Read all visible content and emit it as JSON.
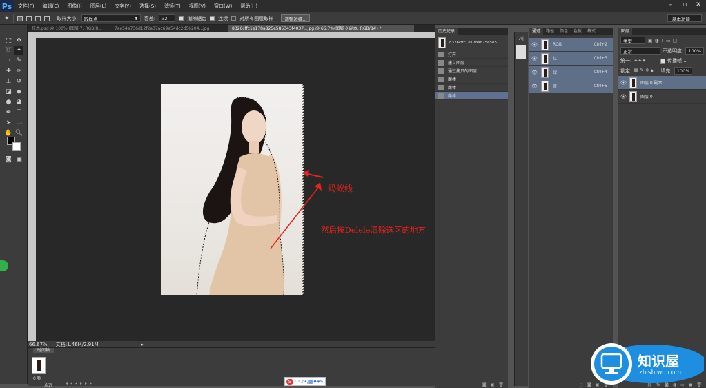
{
  "app": {
    "logo": "Ps"
  },
  "menu": [
    "文件(F)",
    "编辑(E)",
    "图像(I)",
    "图层(L)",
    "文字(Y)",
    "选择(S)",
    "滤镜(T)",
    "视图(V)",
    "窗口(W)",
    "帮助(H)"
  ],
  "window_controls": [
    "–",
    "▫",
    "✕"
  ],
  "options_bar": {
    "sample_size_label": "取样大小:",
    "sample_size_value": "取样点",
    "tolerance_label": "容差:",
    "tolerance_value": "32",
    "antialias_label": "消除锯齿",
    "contiguous_label": "连续",
    "sample_all_label": "对所有图层取样",
    "refine_edge_label": "调整边缘...",
    "workspace": "基本功能"
  },
  "doc_tabs": [
    "技术.psd @ 100% (图层 7, RGB/8...",
    "7ae54e736d12f2e37ac69e54dc2d56204...jpg",
    "8326cffc1e178a825e585343f4037...jpg @ 66.7%(图层 0 副本, RGB/8#) *"
  ],
  "status": {
    "zoom": "66.67%",
    "doc": "文档:1.46M/2.91M"
  },
  "timeline": {
    "tab": "时间轴",
    "frame_delay": "0 秒",
    "loop": "永远"
  },
  "history": {
    "tab": "历史记录",
    "snapshot": "8326cffc1e178a825e585...",
    "items": [
      "打开",
      "建立图层",
      "通过拷贝的图层",
      "魔棒",
      "魔棒",
      "魔棒"
    ]
  },
  "channels": {
    "tabs": [
      "通道",
      "路径",
      "颜色",
      "色板",
      "样式"
    ],
    "rows": [
      {
        "name": "RGB",
        "key": "Ctrl+2"
      },
      {
        "name": "红",
        "key": "Ctrl+3"
      },
      {
        "name": "绿",
        "key": "Ctrl+4"
      },
      {
        "name": "蓝",
        "key": "Ctrl+5"
      }
    ]
  },
  "layers": {
    "tab": "图层",
    "kind": "类型",
    "blend": "正常",
    "opacity_label": "不透明度:",
    "opacity": "100%",
    "lock_label": "锁定:",
    "fill_label": "填充:",
    "fill": "100%",
    "unify_label": "统一:",
    "propagate_label": "传播帧 1",
    "rows": [
      "图层 0 副本",
      "图层 0"
    ]
  },
  "annotations": {
    "marching_ants": "蚂蚁线",
    "instruction": "然后按Delele清除选区的地方"
  },
  "watermark": {
    "cn": "知识屋",
    "url": "zhishiwu.com"
  },
  "ime": "中"
}
